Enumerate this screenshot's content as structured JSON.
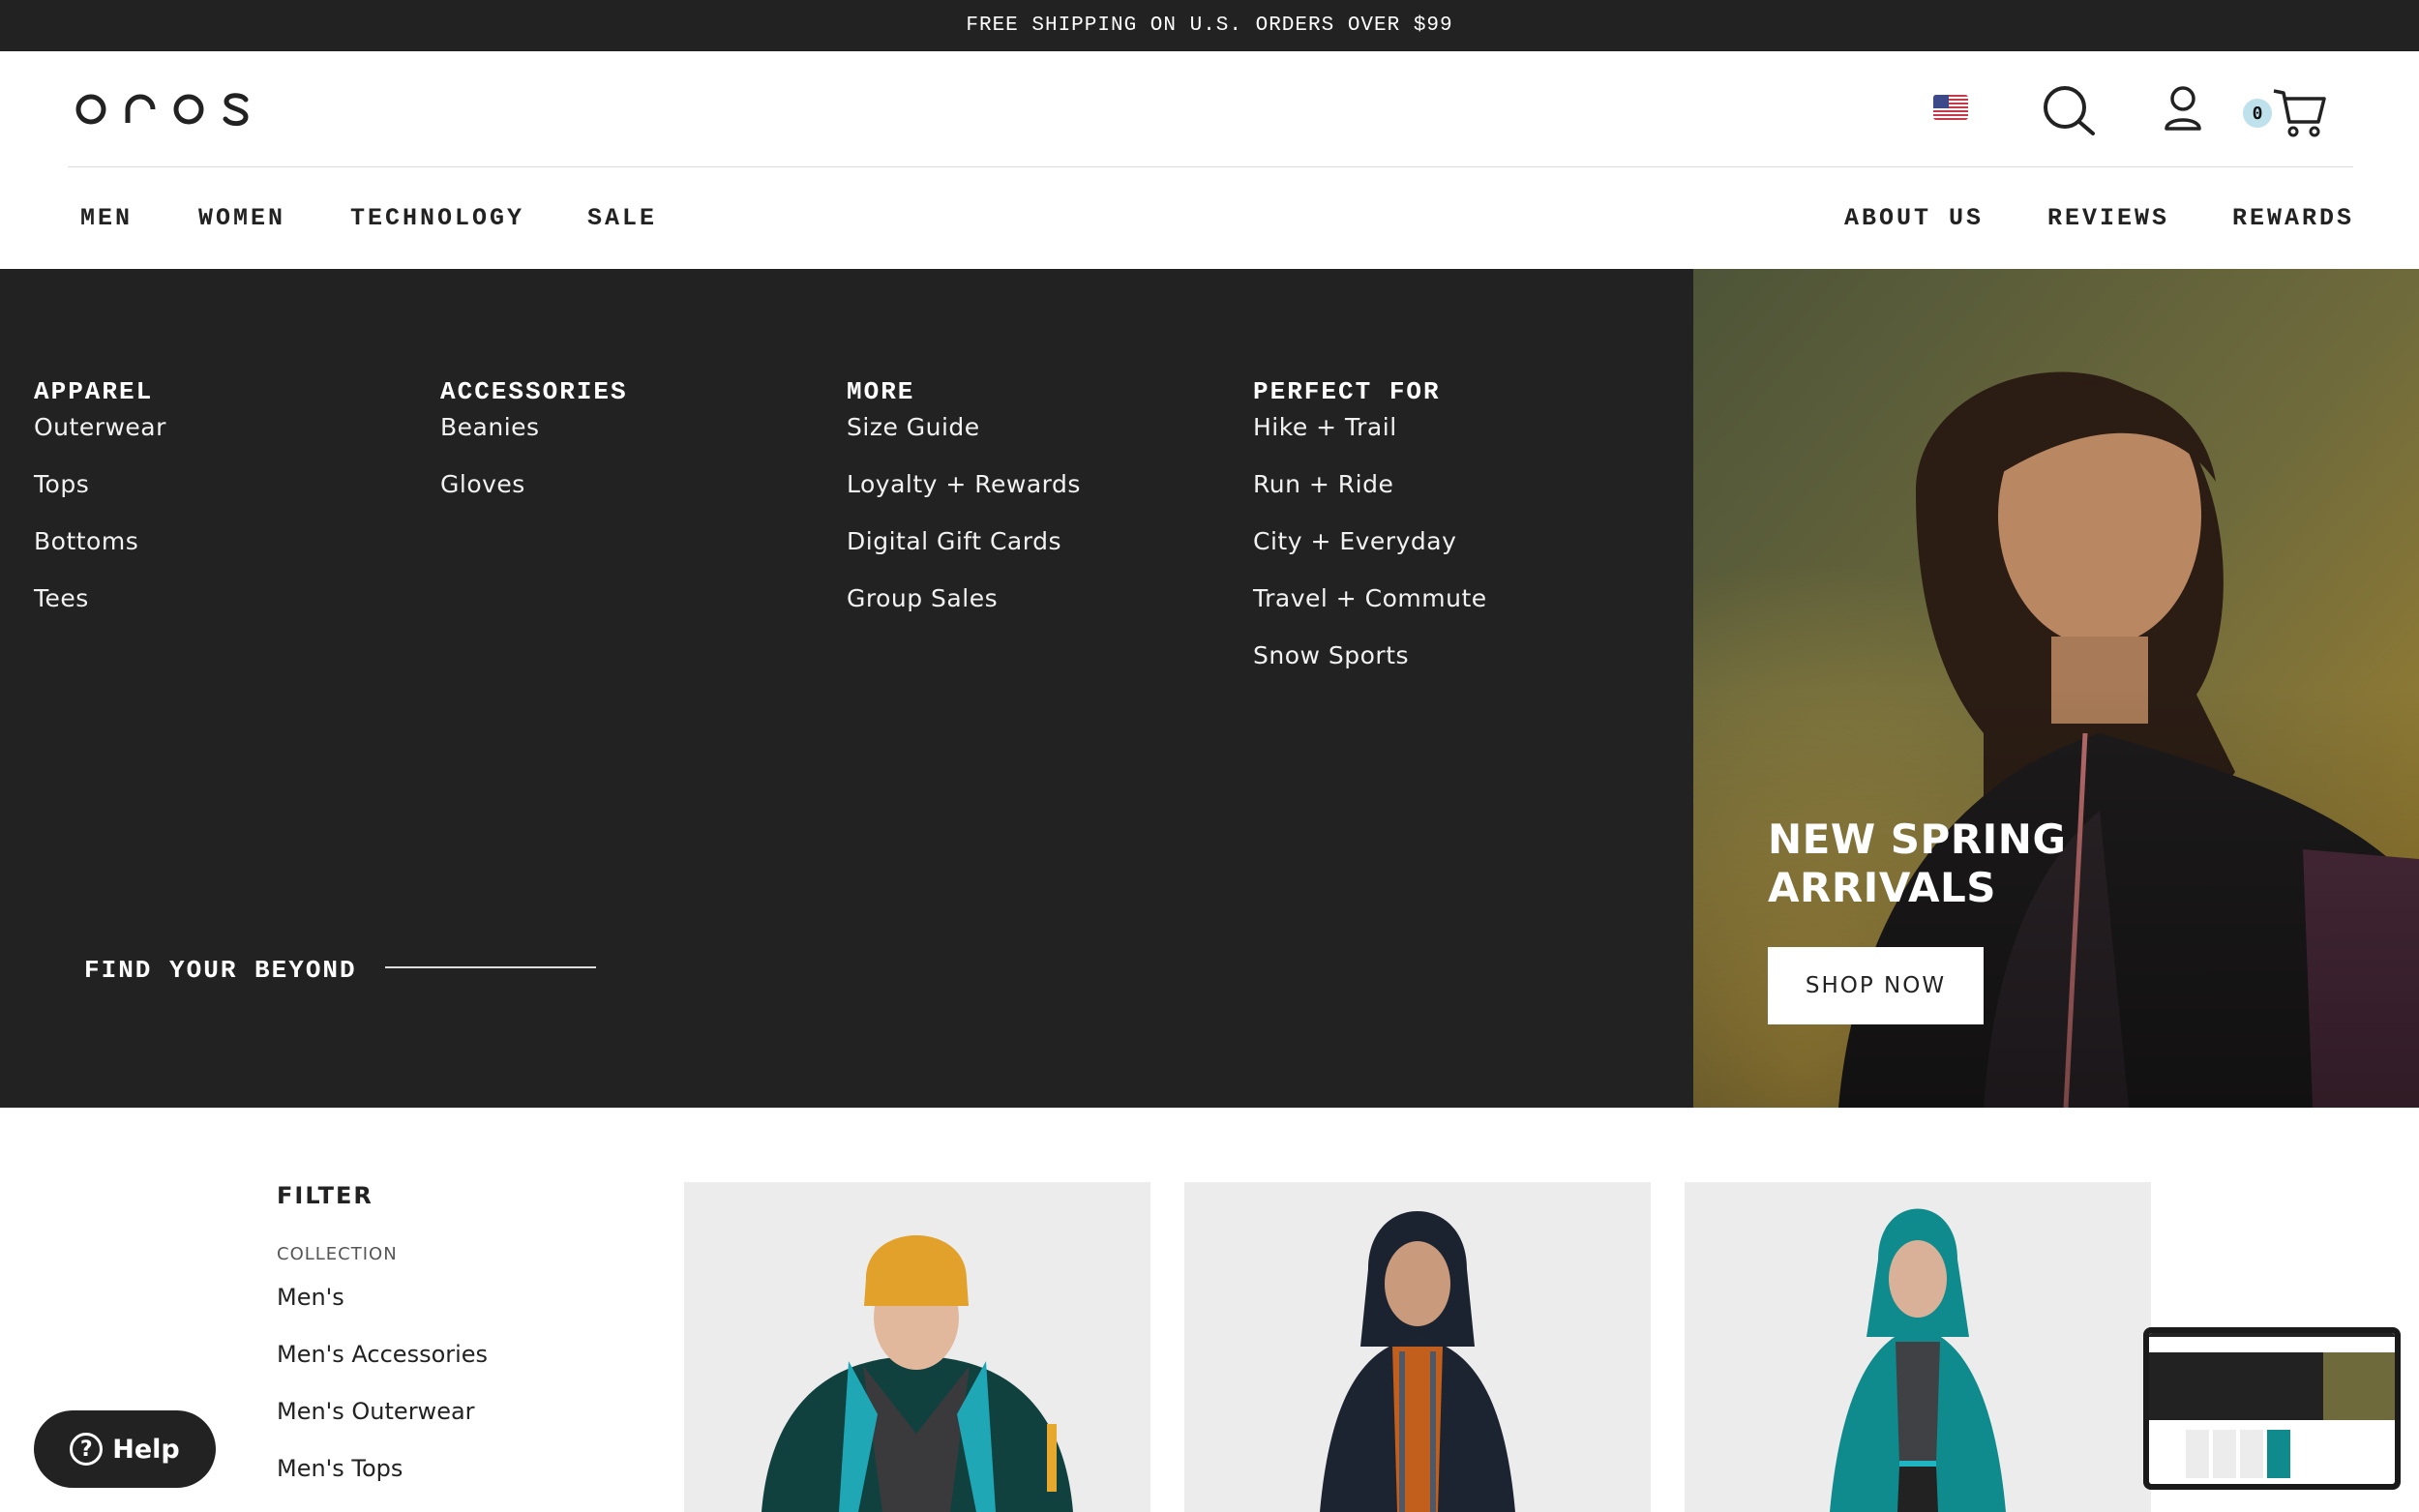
{
  "announcement": "FREE SHIPPING ON U.S. ORDERS OVER $99",
  "brand": {
    "logo": "OROS"
  },
  "header": {
    "flag_icon": "us-flag-icon",
    "search_icon": "search-icon",
    "account_icon": "account-icon",
    "cart_icon": "cart-icon",
    "cart_count": "0"
  },
  "nav": {
    "left": [
      "MEN",
      "WOMEN",
      "TECHNOLOGY",
      "SALE"
    ],
    "right": [
      "ABOUT US",
      "REVIEWS",
      "REWARDS"
    ]
  },
  "mega": {
    "columns": [
      {
        "title": "APPAREL",
        "items": [
          "Outerwear",
          "Tops",
          "Bottoms",
          "Tees"
        ]
      },
      {
        "title": "ACCESSORIES",
        "items": [
          "Beanies",
          "Gloves"
        ]
      },
      {
        "title": "MORE",
        "items": [
          "Size Guide",
          "Loyalty + Rewards",
          "Digital Gift Cards",
          "Group Sales"
        ]
      },
      {
        "title": "PERFECT FOR",
        "items": [
          "Hike + Trail",
          "Run + Ride",
          "City + Everyday",
          "Travel + Commute",
          "Snow Sports"
        ]
      }
    ],
    "tagline": "FIND YOUR BEYOND"
  },
  "promo": {
    "title_line1": "NEW SPRING",
    "title_line2": "ARRIVALS",
    "button": "SHOP NOW"
  },
  "filter": {
    "title": "FILTER",
    "section": "COLLECTION",
    "items": [
      "Men's",
      "Men's Accessories",
      "Men's Outerwear",
      "Men's Tops"
    ]
  },
  "help": {
    "label": "Help",
    "icon": "question-icon"
  },
  "colors": {
    "dark": "#222222",
    "cart_badge": "#bfe1ec",
    "teal_jacket": "#0f8a8d"
  }
}
